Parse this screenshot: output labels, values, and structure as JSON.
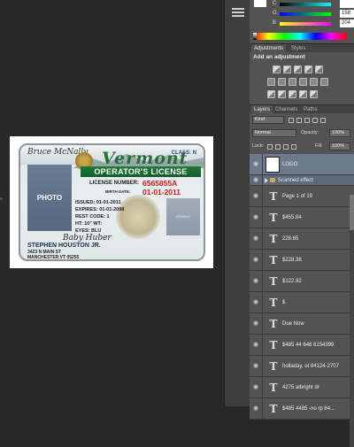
{
  "document": {
    "card": {
      "signature_top": "Bruce McNally",
      "state": "Vermont",
      "class": "CLASS: N",
      "title": "OPERATOR'S LICENSE",
      "photo_label": "PHOTO",
      "license_number_label": "LICENSE NUMBER:",
      "license_number": "6565855A",
      "birth_date_label": "BIRTH DATE:",
      "birth_date": "01-01-2011",
      "issued": "ISSUED:    01-01-2011",
      "expires": "EXPIRES:   01-01-2098",
      "rest_code": "REST CODE: 1",
      "height": "HT:  10\"       WT:",
      "eyes": "EYES:  BLU",
      "signature_bottom": "Baby Huber",
      "name": "STEPHEN HOUSTON JR.",
      "address1": "3423 N MAIN ST",
      "address2": "MANCHESTER VT 05255",
      "ghost_photo": "VERMONT"
    }
  },
  "color_panel": {
    "rows": [
      {
        "letter": "C",
        "value": ""
      },
      {
        "letter": "G",
        "value": "158"
      },
      {
        "letter": "B",
        "value": "204"
      }
    ]
  },
  "adjustments": {
    "tabs": [
      "Adjustments",
      "Styles"
    ],
    "title": "Add an adjustment"
  },
  "layers_panel": {
    "tabs": [
      "Layers",
      "Channels",
      "Paths"
    ],
    "kind_label": "Kind",
    "blend_mode": "Normal",
    "opacity_label": "Opacity:",
    "opacity_value": "100%",
    "lock_label": "Lock:",
    "fill_label": "Fill:",
    "fill_value": "100%",
    "layers": [
      {
        "type": "image",
        "name": "LOGO"
      },
      {
        "type": "group",
        "name": "Scanned effect"
      },
      {
        "type": "text",
        "name": "Page 1 of 19"
      },
      {
        "type": "text",
        "name": "$455.84"
      },
      {
        "type": "text",
        "name": "228.65"
      },
      {
        "type": "text",
        "name": "$228.36"
      },
      {
        "type": "text",
        "name": "$122.92"
      },
      {
        "type": "text",
        "name": "$"
      },
      {
        "type": "text",
        "name": "Due Now"
      },
      {
        "type": "text",
        "name": "$485 44 646 6154399"
      },
      {
        "type": "text",
        "name": "holladay, ut 84124-2707"
      },
      {
        "type": "text",
        "name": "4275 albright dr"
      },
      {
        "type": "text",
        "name": "$485 4485 -no rp 84..."
      }
    ]
  },
  "colors": {
    "canvas_bg": "#282828",
    "panel_bg": "#535353",
    "selected_layer": "#6b7a8d",
    "license_green": "#1f7a3b",
    "license_red": "#c8201e"
  }
}
